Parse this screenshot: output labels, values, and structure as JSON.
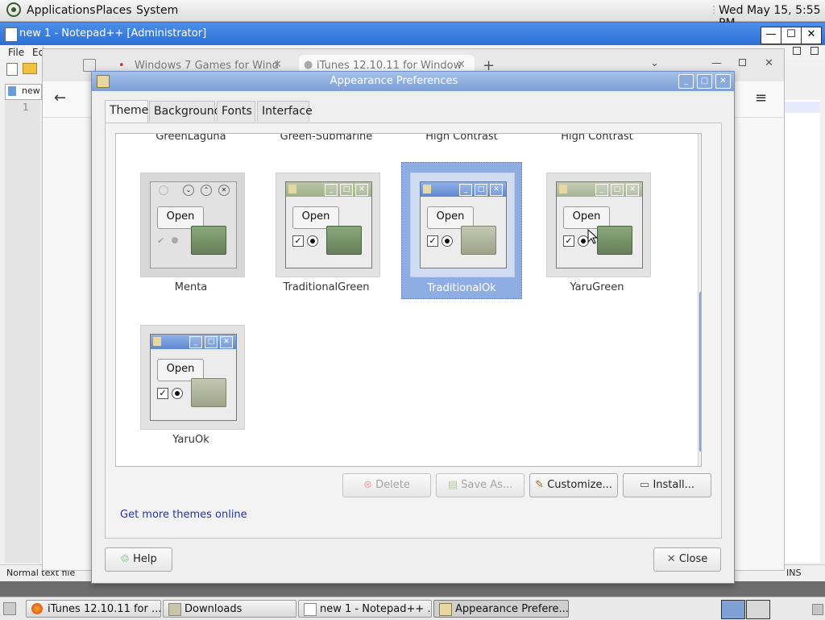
{
  "top_panel": {
    "menus": [
      "Applications",
      "Places",
      "System"
    ],
    "clock": "Wed May 15,  5:55 PM"
  },
  "notepad": {
    "title": "new 1 - Notepad++ [Administrator]",
    "menu": [
      "File",
      "Ed"
    ],
    "tab_label": "new",
    "line_number": "1",
    "status_left": "Normal text file",
    "status_right": "INS"
  },
  "browser": {
    "tabs": [
      "Windows 7 Games for Wind",
      "iTunes 12.10.11 for Window"
    ]
  },
  "dialog": {
    "title": "Appearance Preferences",
    "tabs": [
      "Theme",
      "Background",
      "Fonts",
      "Interface"
    ],
    "header_themes": [
      "GreenLaguna",
      "Green-Submarine",
      "High Contrast",
      "High Contrast"
    ],
    "themes": [
      {
        "name": "Menta",
        "preview_label": "Open",
        "selected": false
      },
      {
        "name": "TraditionalGreen",
        "preview_label": "Open",
        "selected": false
      },
      {
        "name": "TraditionalOk",
        "preview_label": "Open",
        "selected": true
      },
      {
        "name": "YaruGreen",
        "preview_label": "Open",
        "selected": false
      },
      {
        "name": "YaruOk",
        "preview_label": "Open",
        "selected": false
      }
    ],
    "buttons": {
      "delete": "Delete",
      "save_as": "Save As...",
      "customize": "Customize...",
      "install": "Install..."
    },
    "link": "Get more themes online",
    "help": "Help",
    "close": "Close"
  },
  "taskbar": {
    "items": [
      "iTunes 12.10.11 for ...",
      "Downloads",
      "new 1 - Notepad++ ...",
      "Appearance Prefere..."
    ]
  },
  "colors": {
    "selection": "#8eaee3",
    "dialog_title": "#7c9fd6",
    "link": "#2233aa"
  }
}
